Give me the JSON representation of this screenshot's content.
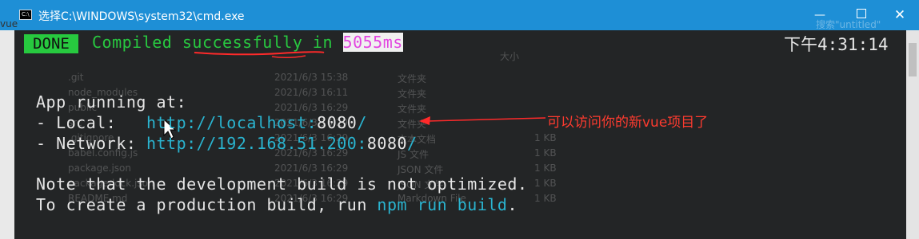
{
  "window": {
    "title": "选择C:\\WINDOWS\\system32\\cmd.exe",
    "app_icon_text": "C:\\",
    "min_glyph": "—",
    "close_glyph": "✕"
  },
  "terminal": {
    "done_badge": "DONE",
    "compiled_prefix": "Compiled ",
    "compiled_word": "successfully",
    "compiled_in": " in ",
    "compiled_time": "5055ms",
    "clock": "下午4:31:14",
    "app_running": "App running at:",
    "local_label": "- Local:   ",
    "local_url": "http://localhost:",
    "local_port": "8080",
    "local_slash": "/",
    "network_label": "- Network: ",
    "network_url": "http://192.168.51.200:",
    "network_port": "8080",
    "network_slash": "/",
    "note1": "Note that the development build is not optimized.",
    "note2_prefix": "To create a production build, run ",
    "note2_cmd": "npm run build",
    "note2_suffix": "."
  },
  "annotation": {
    "text": "可以访问你的新vue项目了",
    "color": "#ff3b2f"
  },
  "background_listing": {
    "left_fragment": "vue",
    "rows": [
      {
        "name": ".git",
        "date": "2021/6/3 15:38",
        "type": "文件夹",
        "size": ""
      },
      {
        "name": "node_modules",
        "date": "2021/6/3 16:11",
        "type": "文件夹",
        "size": ""
      },
      {
        "name": "public",
        "date": "2021/6/3 16:29",
        "type": "文件夹",
        "size": ""
      },
      {
        "name": "src",
        "date": "2021/6/3 16:29",
        "type": "文件夹",
        "size": ""
      },
      {
        "name": ".gitignore",
        "date": "2021/6/3 16:29",
        "type": "文本文档",
        "size": "1 KB"
      },
      {
        "name": "babel.config.js",
        "date": "2021/6/3 16:29",
        "type": "JS 文件",
        "size": "1 KB"
      },
      {
        "name": "package.json",
        "date": "2021/6/3 16:29",
        "type": "JSON 文件",
        "size": "1 KB"
      },
      {
        "name": "package-lock.json",
        "date": "2021/6/3 16:29",
        "type": "JSON 文件",
        "size": "1 KB"
      },
      {
        "name": "README.md",
        "date": "2021/6/3 16:29",
        "type": "Markdown File",
        "size": "1 KB"
      }
    ],
    "header_size": "大小",
    "search_hint": "搜索\"untitled\""
  }
}
